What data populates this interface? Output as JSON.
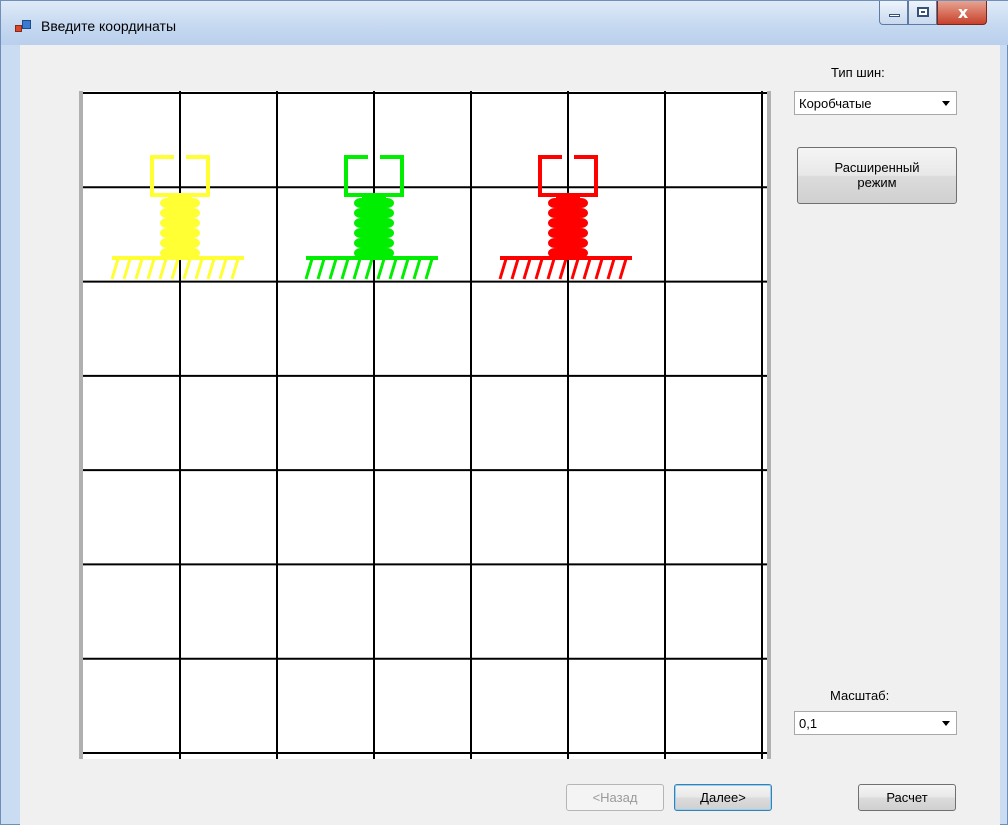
{
  "window": {
    "title": "Введите координаты",
    "minimize_label": "",
    "maximize_label": "",
    "close_label": "x"
  },
  "sidebar": {
    "tire_type_label": "Тип шин:",
    "tire_type_value": "Коробчатые",
    "extended_mode_line1": "Расширенный",
    "extended_mode_line2": "режим",
    "scale_label": "Масштаб:",
    "scale_value": "0,1"
  },
  "footer": {
    "back_label": "<Назад",
    "next_label": "Далее>",
    "calc_label": "Расчет"
  },
  "canvas": {
    "grid": {
      "columns": 7,
      "rows": 7,
      "line_color": "#000000"
    },
    "supports": [
      {
        "name": "yellow",
        "color": "#ffff33"
      },
      {
        "name": "green",
        "color": "#00ee00"
      },
      {
        "name": "red",
        "color": "#ff0000"
      }
    ]
  },
  "colors": {
    "window_border": "#6f8fb8",
    "client_bg": "#f0f0f0"
  }
}
